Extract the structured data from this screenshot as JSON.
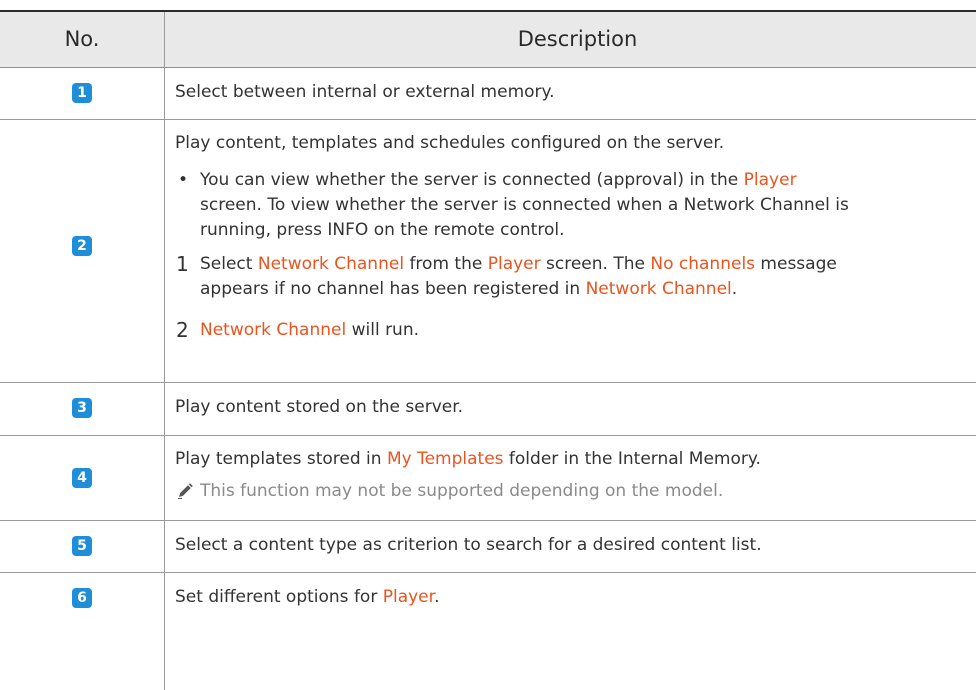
{
  "table": {
    "headers": {
      "no": "No.",
      "description": "Description"
    },
    "rows": [
      {
        "badge": "1",
        "text": "Select between internal or external memory."
      },
      {
        "badge": "2",
        "intro": "Play content, templates and schedules configured on the server.",
        "bullet": {
          "mark": "•",
          "line1_a": "You can view whether the server is connected (approval) in the ",
          "line1_hl": "Player",
          "line2": "screen. To view whether the server is connected when a Network Channel is",
          "line3_a": "running, press ",
          "line3_b": "INFO",
          "line3_c": " on the remote control."
        },
        "step1": {
          "num": "1",
          "line1_a": "Select ",
          "line1_hl1": "Network Channel",
          "line1_b": " from the ",
          "line1_hl2": "Player",
          "line1_c": " screen. The ",
          "line1_hl3": "No channels",
          "line1_d": " message",
          "line2_a": "appears if no channel has been registered in ",
          "line2_hl": "Network Channel",
          "line2_b": "."
        },
        "step2": {
          "num": "2",
          "hl": "Network Channel",
          "rest": " will run."
        }
      },
      {
        "badge": "3",
        "text": "Play content stored on the server."
      },
      {
        "badge": "4",
        "text_a": "Play templates stored in ",
        "text_hl": "My Templates",
        "text_b": " folder in the Internal Memory.",
        "note": "This function may not be supported depending on the model.",
        "note_icon": "pencil-icon"
      },
      {
        "badge": "5",
        "text": "Select a content type as criterion to search for a desired content list."
      },
      {
        "badge": "6",
        "text_a": "Set different options for ",
        "text_hl": "Player",
        "text_b": "."
      }
    ]
  },
  "colors": {
    "highlight": "#e9541f",
    "badge": "#1e8ed8",
    "header_bg": "#e9e9e9",
    "note": "#8a8a8a"
  }
}
